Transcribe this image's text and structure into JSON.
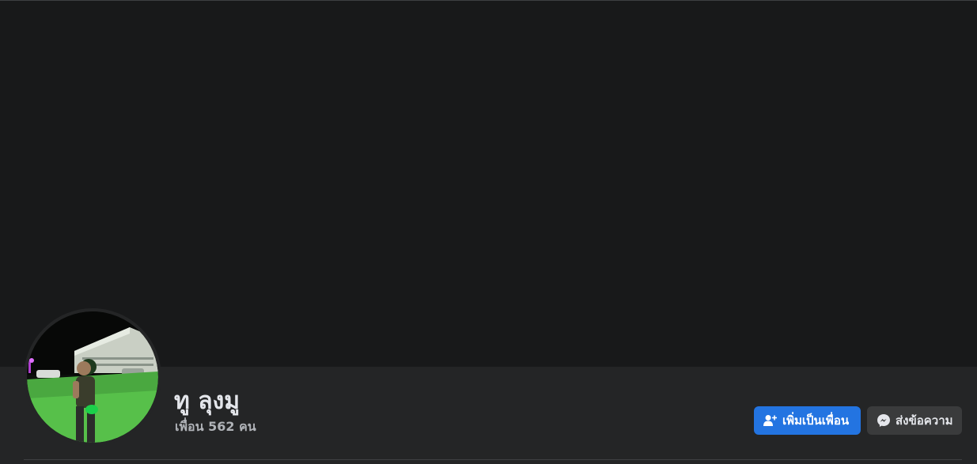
{
  "profile": {
    "name": "ทู ลุงมู",
    "friends_count": "เพื่อน 562 คน"
  },
  "actions": {
    "add_friend_label": "เพิ่มเป็นเพื่อน",
    "message_label": "ส่งข้อความ"
  },
  "icons": {
    "add_friend": "add-friend-icon",
    "messenger": "messenger-icon"
  },
  "colors": {
    "background": "#242526",
    "cover": "#18191a",
    "primary_button": "#2374e1",
    "secondary_button": "#3a3b3c",
    "text_primary": "#e4e6eb",
    "text_secondary": "#b0b3b8"
  }
}
